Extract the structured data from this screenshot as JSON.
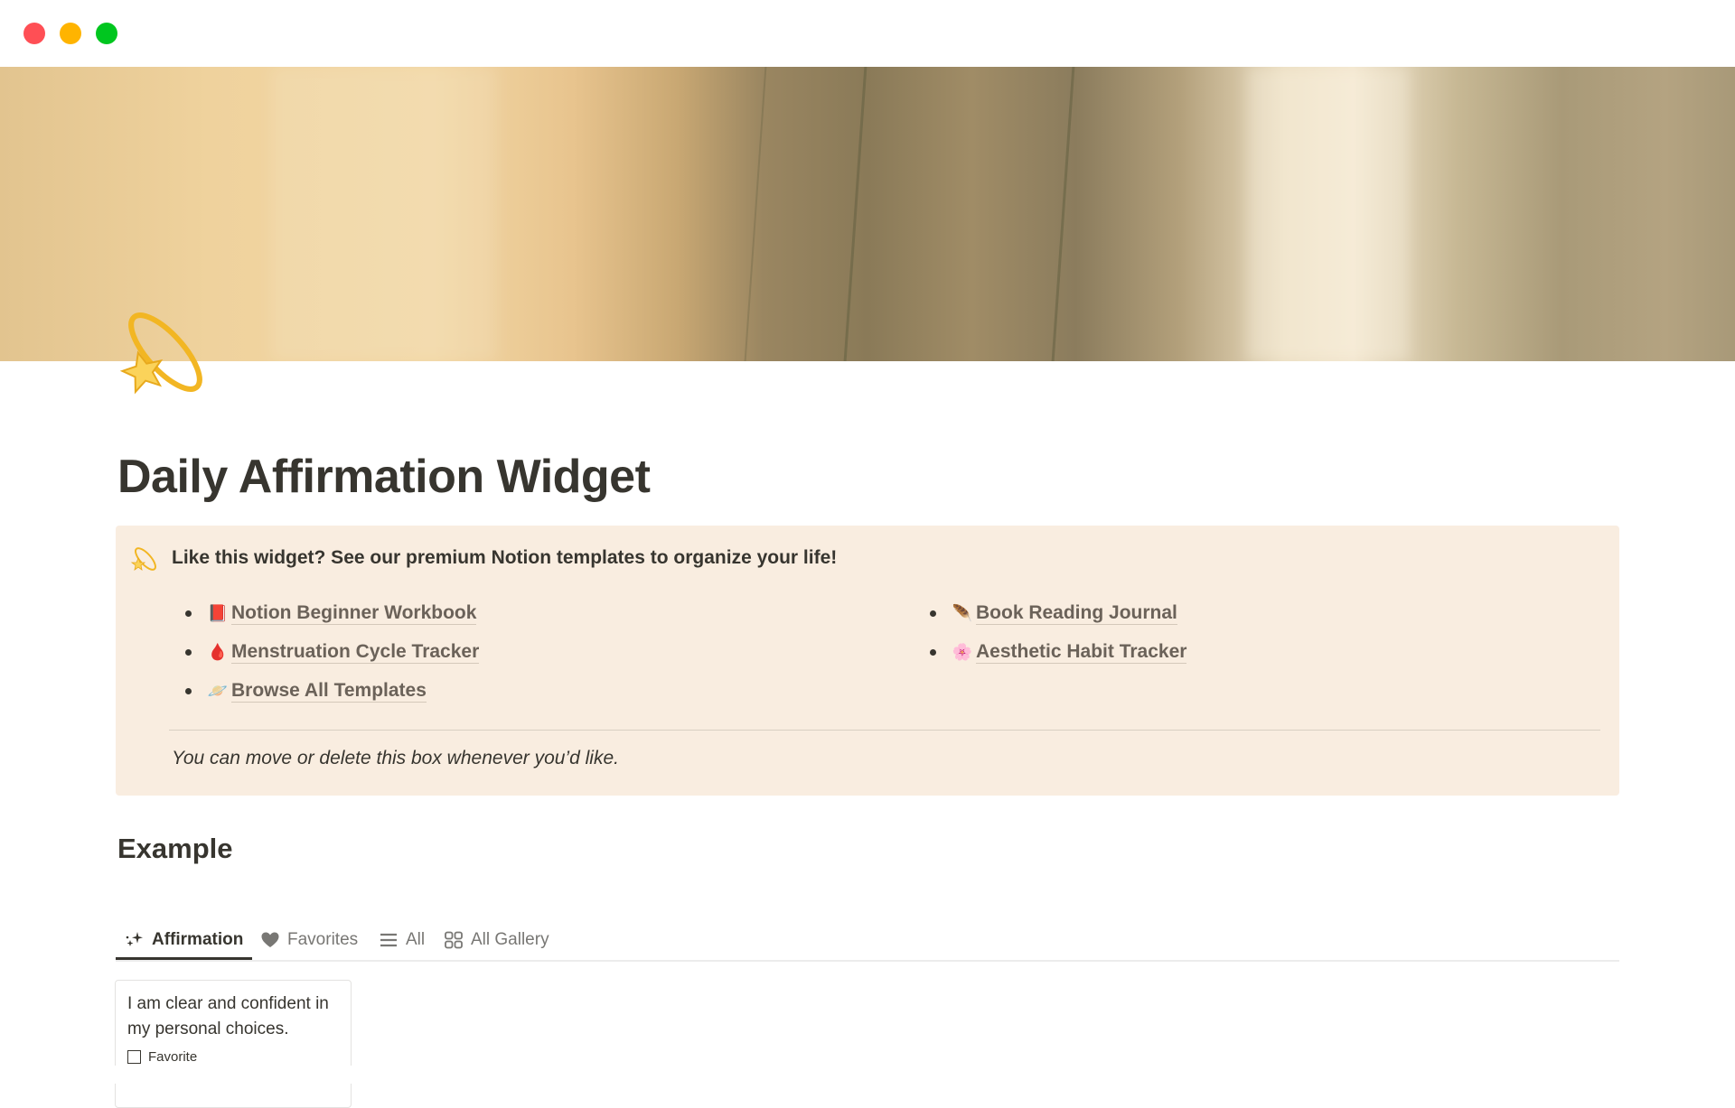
{
  "window": {
    "controls": [
      "close",
      "minimize",
      "maximize"
    ]
  },
  "page": {
    "icon": "dizzy-star-emoji",
    "title": "Daily Affirmation Widget"
  },
  "callout": {
    "icon": "dizzy-star-emoji",
    "header": "Like this widget? See our premium Notion templates to organize your life!",
    "links_left": [
      {
        "emoji": "📕",
        "icon": "red-book-icon",
        "label": "Notion Beginner Workbook"
      },
      {
        "emoji": "🩸",
        "icon": "blood-drop-icon",
        "label": "Menstruation Cycle Tracker"
      },
      {
        "emoji": "🪐",
        "icon": "ringed-planet-icon",
        "label": "Browse All Templates"
      }
    ],
    "links_right": [
      {
        "emoji": "🪶",
        "icon": "feather-icon",
        "label": "Book Reading Journal"
      },
      {
        "emoji": "🌸",
        "icon": "cherry-blossom-icon",
        "label": "Aesthetic Habit Tracker"
      }
    ],
    "note": "You can move or delete this box whenever you’d like.",
    "background": "#F9EDE0"
  },
  "section": {
    "heading": "Example"
  },
  "tabs": [
    {
      "label": "Affirmation",
      "icon": "sparkles-icon",
      "active": true
    },
    {
      "label": "Favorites",
      "icon": "heart-icon",
      "active": false
    },
    {
      "label": "All",
      "icon": "list-icon",
      "active": false
    },
    {
      "label": "All Gallery",
      "icon": "gallery-icon",
      "active": false
    }
  ],
  "cards": [
    {
      "text": "I am clear and confident in my personal choices.",
      "property_label": "Favorite",
      "checked": false
    }
  ]
}
